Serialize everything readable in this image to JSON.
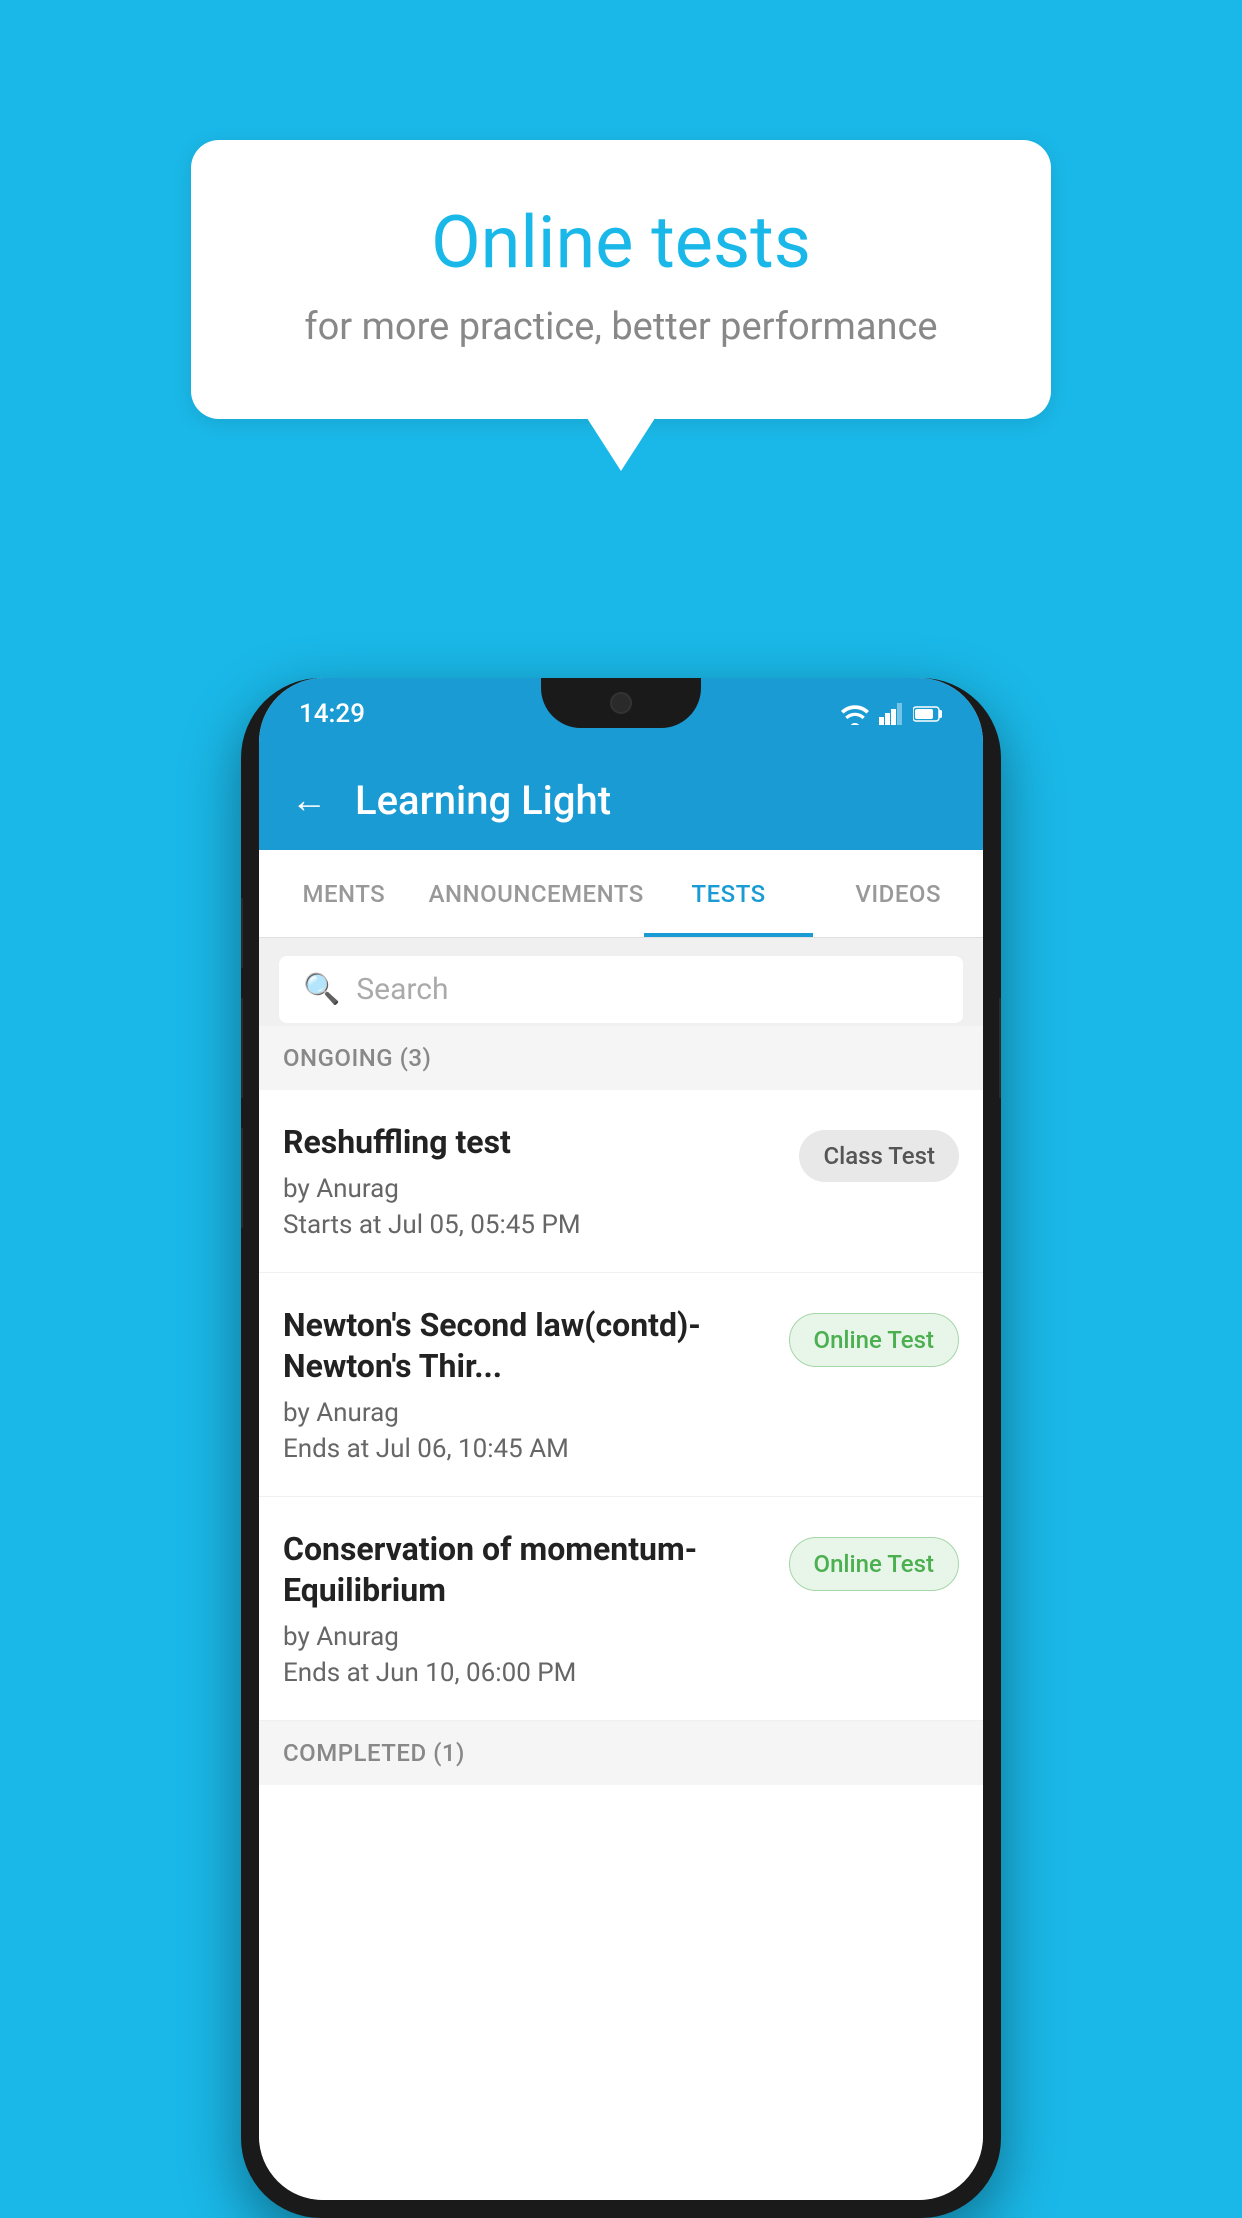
{
  "background_color": "#1ab8e8",
  "bubble": {
    "title": "Online tests",
    "subtitle": "for more practice, better performance"
  },
  "phone": {
    "status_bar": {
      "time": "14:29",
      "icons": [
        "wifi",
        "signal",
        "battery"
      ]
    },
    "header": {
      "title": "Learning Light",
      "back_label": "←"
    },
    "tabs": [
      {
        "label": "MENTS",
        "active": false
      },
      {
        "label": "ANNOUNCEMENTS",
        "active": false
      },
      {
        "label": "TESTS",
        "active": true
      },
      {
        "label": "VIDEOS",
        "active": false
      }
    ],
    "search": {
      "placeholder": "Search"
    },
    "ongoing_section": {
      "label": "ONGOING (3)",
      "items": [
        {
          "title": "Reshuffling test",
          "author": "by Anurag",
          "time_label": "Starts at",
          "time": "Jul 05, 05:45 PM",
          "badge": "Class Test",
          "badge_type": "class"
        },
        {
          "title": "Newton's Second law(contd)-Newton's Thir...",
          "author": "by Anurag",
          "time_label": "Ends at",
          "time": "Jul 06, 10:45 AM",
          "badge": "Online Test",
          "badge_type": "online"
        },
        {
          "title": "Conservation of momentum-Equilibrium",
          "author": "by Anurag",
          "time_label": "Ends at",
          "time": "Jun 10, 06:00 PM",
          "badge": "Online Test",
          "badge_type": "online"
        }
      ]
    },
    "completed_section": {
      "label": "COMPLETED (1)"
    }
  }
}
